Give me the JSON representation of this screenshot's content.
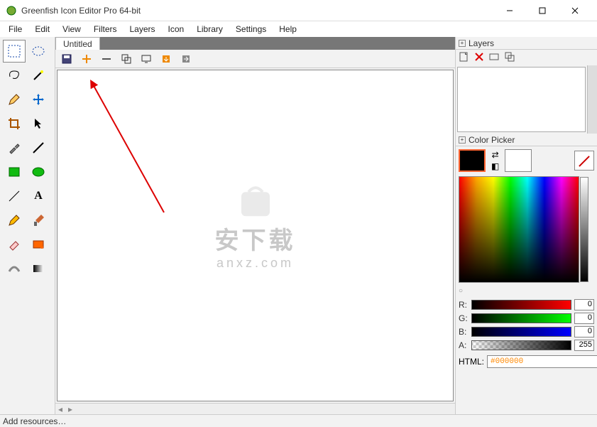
{
  "titlebar": {
    "title": "Greenfish Icon Editor Pro 64-bit"
  },
  "menu": {
    "items": [
      "File",
      "Edit",
      "View",
      "Filters",
      "Layers",
      "Icon",
      "Library",
      "Settings",
      "Help"
    ]
  },
  "tabs": {
    "active": "Untitled"
  },
  "doc_toolbar": {
    "icons": [
      "save-icon",
      "plus-icon",
      "minus-icon",
      "duplicate-icon",
      "monitor-icon",
      "arrow-down-icon",
      "arrow-right-icon"
    ]
  },
  "tools": [
    "select-rect",
    "select-freehand",
    "lasso",
    "wand",
    "pencil",
    "move",
    "crop",
    "pointer",
    "eyedropper",
    "line",
    "rect-fill",
    "ellipse-fill",
    "line-tool",
    "text",
    "brush",
    "paint-brush",
    "eraser",
    "gradient",
    "smudge",
    "shape"
  ],
  "layers": {
    "title": "Layers",
    "tool_icons": [
      "new-layer-icon",
      "delete-layer-icon",
      "duplicate-layer-icon",
      "merge-layer-icon"
    ]
  },
  "color_picker": {
    "title": "Color Picker",
    "r": 0,
    "g": 0,
    "b": 0,
    "a": 255,
    "html_label": "HTML:",
    "html_value": "#000000",
    "labels": {
      "r": "R:",
      "g": "G:",
      "b": "B:",
      "a": "A:"
    }
  },
  "statusbar": {
    "text": "Add resources…"
  },
  "watermark": {
    "top": "安下载",
    "bottom": "anxz.com"
  }
}
